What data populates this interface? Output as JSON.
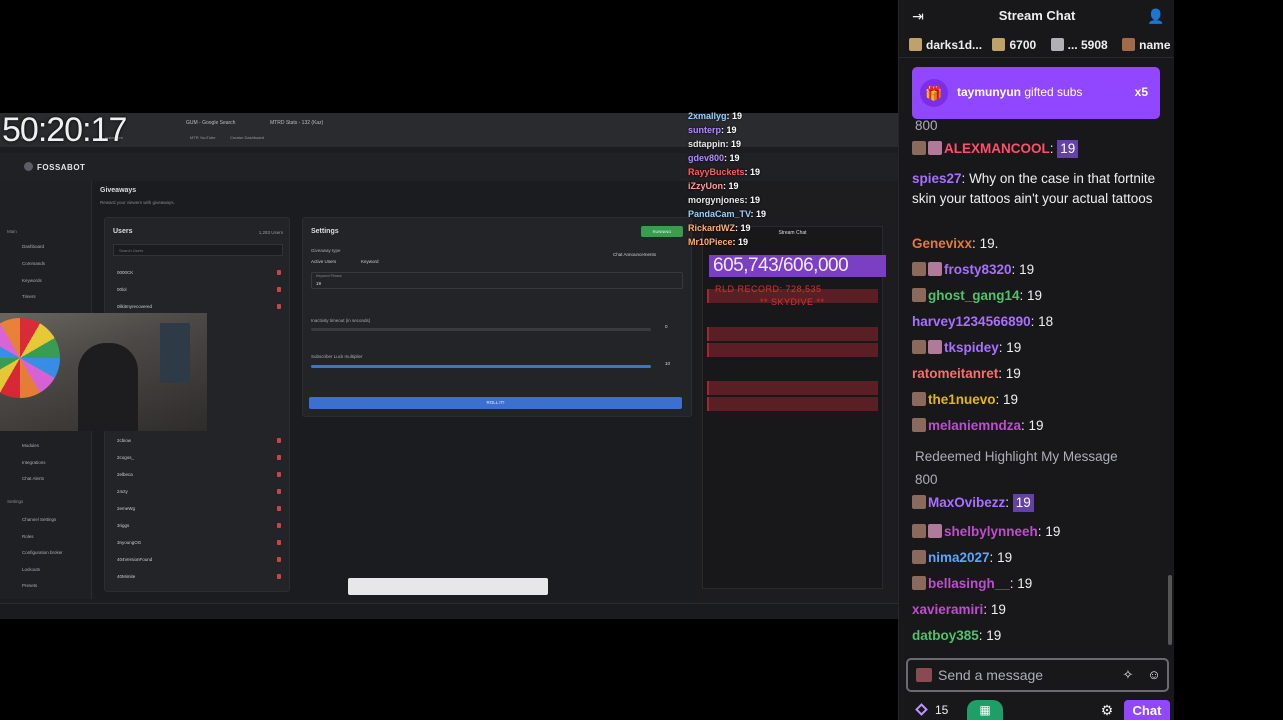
{
  "stream": {
    "timer": "50:20:17",
    "subs_goal": "605,743/606,000",
    "record_line1": "RLD RECORD: 728,535",
    "record_line2": "** SKYDIVE **",
    "overlay_chat": [
      {
        "user": "2xmallyg",
        "text": "19",
        "color": "#9ad0ff"
      },
      {
        "user": "sunterp",
        "text": "19",
        "color": "#b48cff"
      },
      {
        "user": "sdtappin",
        "text": "19",
        "color": "#e6e6e6"
      },
      {
        "user": "gdev800",
        "text": "19",
        "color": "#b48cff"
      },
      {
        "user": "RayyBuckets",
        "text": "19",
        "color": "#ff5c5c"
      },
      {
        "user": "iZzyUon",
        "text": "19",
        "color": "#ff9c9c"
      },
      {
        "user": "morgynjones",
        "text": "19",
        "color": "#e6e6e6"
      },
      {
        "user": "PandaCam_TV",
        "text": "19",
        "color": "#9ad0ff"
      },
      {
        "user": "RickardWZ",
        "text": "19",
        "color": "#ffb070"
      },
      {
        "user": "Mr10Piece",
        "text": "19",
        "color": "#ffb070"
      }
    ]
  },
  "screen": {
    "tabs": [
      "GUM - Google Search",
      "MTRD Stats - 132 (Kaz)"
    ],
    "bookmarks": [
      "Twitch",
      "Instagram",
      "MTR YouTube",
      "Creator Dashboard"
    ],
    "brand": "FOSSABOT",
    "page_title": "Giveaways",
    "page_subtitle": "Reward your viewers with giveaways.",
    "users_title": "Users",
    "users_count": "1,283 Users",
    "search_label": "Search Users",
    "users": [
      "0000CK",
      "00lol",
      "0ilkitmyrecovered",
      "2cbiow",
      "2cogos_",
      "2elbeca",
      "24cty",
      "2emeWg",
      "3riggs",
      "3nyoungOG",
      "404VersionFound",
      "40Mimite"
    ],
    "settings_title": "Settings",
    "running_badge": "RUNNING",
    "giveaway_type_label": "Giveaway type",
    "type_options": [
      "Active Users",
      "Keyword"
    ],
    "chat_announcements": "Chat Announcements",
    "keyword_label": "Keyword Phrase",
    "keyword_value": "19",
    "inactivity_label": "Inactivity timeout (in seconds)",
    "inactivity_value": "0",
    "multiplier_label": "Subscriber Luck multiplier",
    "multiplier_value": "10",
    "roll_button": "ROLL IT!",
    "side_sections": [
      "Main",
      "Settings"
    ],
    "side_items": [
      "Dashboard",
      "Commands",
      "Keywords",
      "Timers",
      "Modules",
      "Integrations",
      "Chat Alerts",
      "Channel Settings",
      "Roles",
      "Configuration broker",
      "Lockouts",
      "Presets"
    ],
    "inner_chat_title": "Stream Chat"
  },
  "chat": {
    "title": "Stream Chat",
    "leaderboard": [
      {
        "name": "darks1d...",
        "count": "",
        "tier": "gold"
      },
      {
        "name": "",
        "count": "6700",
        "tier": "gold"
      },
      {
        "name": "...",
        "count": "5908",
        "tier": "silver"
      },
      {
        "name": "name",
        "count": "",
        "tier": "bronze"
      }
    ],
    "gift_banner": {
      "user": "taymunyun",
      "text": "gifted subs",
      "count": "x5"
    },
    "messages": [
      {
        "kind": "sys",
        "text": "800"
      },
      {
        "user": "ALEXMANCOOL",
        "color": "#ff4f6a",
        "text": "19",
        "emote": true,
        "badges": 2
      },
      {
        "user": "spies27",
        "color": "#a970ff",
        "text": "Why on the case in that fortnite skin your tattoos ain't your actual tattoos",
        "badges": 0
      },
      {
        "user": "Genevixx",
        "color": "#e07b39",
        "text": "19.",
        "badges": 0
      },
      {
        "user": "frosty8320",
        "color": "#a970ff",
        "text": "19",
        "badges": 2
      },
      {
        "user": "ghost_gang14",
        "color": "#4fc26a",
        "text": "19",
        "badges": 1
      },
      {
        "user": "harvey1234566890",
        "color": "#a970ff",
        "text": "18",
        "badges": 0
      },
      {
        "user": "tkspidey",
        "color": "#a970ff",
        "text": "19",
        "badges": 2
      },
      {
        "user": "ratomeitanret",
        "color": "#ff6b6b",
        "text": "19",
        "badges": 0
      },
      {
        "user": "the1nuevo",
        "color": "#e6b800",
        "text": "19",
        "badges": 1
      },
      {
        "user": "melaniemndza",
        "color": "#c04ccf",
        "text": "19",
        "badges": 1
      },
      {
        "kind": "sys",
        "text": "Redeemed Highlight My Message"
      },
      {
        "kind": "sys",
        "text": "800"
      },
      {
        "user": "MaxOvibezz",
        "color": "#a970ff",
        "text": "19",
        "emote": true,
        "badges": 1
      },
      {
        "user": "shelbylynneeh",
        "color": "#c04ccf",
        "text": "19",
        "badges": 2
      },
      {
        "user": "nima2027",
        "color": "#58a6ff",
        "text": "19",
        "badges": 1
      },
      {
        "user": "bellasingh__",
        "color": "#c04ccf",
        "text": "19",
        "badges": 1
      },
      {
        "user": "xavieramiri",
        "color": "#c04ccf",
        "text": "19",
        "badges": 0
      },
      {
        "user": "datboy385",
        "color": "#4fc26a",
        "text": "19",
        "badges": 0
      }
    ],
    "input_placeholder": "Send a message",
    "points": "15",
    "chat_button": "Chat"
  }
}
